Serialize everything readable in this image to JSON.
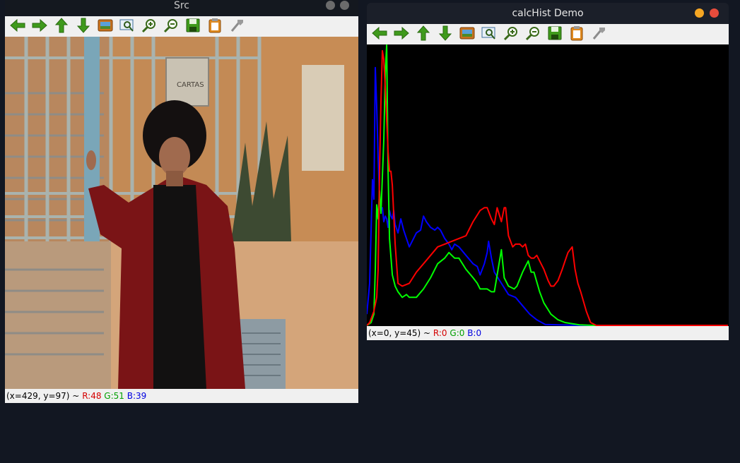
{
  "src_window": {
    "title": "Src",
    "status": {
      "coords": "(x=429, y=97) ~",
      "r": "R:48",
      "g": "G:51",
      "b": "B:39"
    },
    "photo": {
      "sign_text": "CARTAS"
    }
  },
  "hist_window": {
    "title": "calcHist Demo",
    "status": {
      "coords": "(x=0, y=45) ~",
      "r": "R:0",
      "g": "G:0",
      "b": "B:0"
    }
  },
  "toolbar_icons": [
    "pan-left-icon",
    "pan-right-icon",
    "pan-up-icon",
    "pan-down-icon",
    "zoom-fit-icon",
    "zoom-area-icon",
    "zoom-in-icon",
    "zoom-out-icon",
    "save-icon",
    "copy-icon",
    "properties-icon"
  ],
  "colors": {
    "red_channel": "#ff0000",
    "green_channel": "#00ff00",
    "blue_channel": "#0000ff",
    "min_button": "#f5a623",
    "close_button": "#e74c3c",
    "inactive_button": "#6b6b6b"
  },
  "chart_data": {
    "type": "line",
    "title": "",
    "xlabel": "",
    "ylabel": "",
    "xlim": [
      0,
      255
    ],
    "ylim": [
      0,
      1
    ],
    "grid": false,
    "series": [
      {
        "color": "blue",
        "points": [
          [
            0,
            0.04
          ],
          [
            2,
            0.15
          ],
          [
            4,
            0.52
          ],
          [
            5,
            0.45
          ],
          [
            6,
            0.92
          ],
          [
            7,
            0.78
          ],
          [
            8,
            0.6
          ],
          [
            9,
            0.46
          ],
          [
            10,
            0.41
          ],
          [
            11,
            0.42
          ],
          [
            12,
            0.37
          ],
          [
            13,
            0.39
          ],
          [
            14,
            0.38
          ],
          [
            15,
            0.35
          ],
          [
            16,
            0.41
          ],
          [
            17,
            0.39
          ],
          [
            18,
            0.38
          ],
          [
            19,
            0.41
          ],
          [
            20,
            0.36
          ],
          [
            22,
            0.33
          ],
          [
            24,
            0.38
          ],
          [
            26,
            0.34
          ],
          [
            28,
            0.31
          ],
          [
            30,
            0.28
          ],
          [
            32,
            0.3
          ],
          [
            35,
            0.33
          ],
          [
            38,
            0.34
          ],
          [
            40,
            0.39
          ],
          [
            42,
            0.37
          ],
          [
            45,
            0.35
          ],
          [
            48,
            0.34
          ],
          [
            50,
            0.35
          ],
          [
            52,
            0.34
          ],
          [
            55,
            0.31
          ],
          [
            58,
            0.29
          ],
          [
            60,
            0.27
          ],
          [
            62,
            0.29
          ],
          [
            65,
            0.28
          ],
          [
            70,
            0.25
          ],
          [
            75,
            0.22
          ],
          [
            78,
            0.21
          ],
          [
            80,
            0.18
          ],
          [
            83,
            0.22
          ],
          [
            85,
            0.26
          ],
          [
            86,
            0.3
          ],
          [
            88,
            0.24
          ],
          [
            90,
            0.19
          ],
          [
            95,
            0.15
          ],
          [
            100,
            0.11
          ],
          [
            105,
            0.1
          ],
          [
            110,
            0.07
          ],
          [
            115,
            0.04
          ],
          [
            120,
            0.02
          ],
          [
            126,
            0.003
          ],
          [
            150,
            0
          ],
          [
            255,
            0
          ]
        ]
      },
      {
        "color": "green",
        "points": [
          [
            0,
            0
          ],
          [
            3,
            0.01
          ],
          [
            5,
            0.04
          ],
          [
            6,
            0.2
          ],
          [
            7,
            0.43
          ],
          [
            8,
            0.38
          ],
          [
            9,
            0.48
          ],
          [
            10,
            0.4
          ],
          [
            12,
            0.66
          ],
          [
            13,
            0.9
          ],
          [
            14,
            1.0
          ],
          [
            15,
            0.55
          ],
          [
            16,
            0.31
          ],
          [
            18,
            0.18
          ],
          [
            20,
            0.14
          ],
          [
            22,
            0.12
          ],
          [
            25,
            0.1
          ],
          [
            28,
            0.11
          ],
          [
            30,
            0.1
          ],
          [
            35,
            0.1
          ],
          [
            40,
            0.13
          ],
          [
            45,
            0.17
          ],
          [
            50,
            0.22
          ],
          [
            55,
            0.24
          ],
          [
            58,
            0.26
          ],
          [
            60,
            0.25
          ],
          [
            62,
            0.24
          ],
          [
            65,
            0.24
          ],
          [
            70,
            0.2
          ],
          [
            75,
            0.17
          ],
          [
            78,
            0.15
          ],
          [
            80,
            0.13
          ],
          [
            85,
            0.13
          ],
          [
            88,
            0.12
          ],
          [
            90,
            0.12
          ],
          [
            93,
            0.21
          ],
          [
            95,
            0.27
          ],
          [
            97,
            0.17
          ],
          [
            100,
            0.14
          ],
          [
            104,
            0.13
          ],
          [
            106,
            0.14
          ],
          [
            110,
            0.19
          ],
          [
            112,
            0.21
          ],
          [
            114,
            0.23
          ],
          [
            116,
            0.19
          ],
          [
            118,
            0.19
          ],
          [
            122,
            0.12
          ],
          [
            125,
            0.08
          ],
          [
            130,
            0.04
          ],
          [
            135,
            0.02
          ],
          [
            140,
            0.01
          ],
          [
            150,
            0.002
          ],
          [
            160,
            0
          ],
          [
            255,
            0
          ]
        ]
      },
      {
        "color": "red",
        "points": [
          [
            0,
            0
          ],
          [
            2,
            0.01
          ],
          [
            5,
            0.05
          ],
          [
            7,
            0.1
          ],
          [
            8,
            0.2
          ],
          [
            9,
            0.55
          ],
          [
            10,
            0.8
          ],
          [
            11,
            0.98
          ],
          [
            12,
            0.95
          ],
          [
            13,
            0.85
          ],
          [
            15,
            0.62
          ],
          [
            16,
            0.55
          ],
          [
            17,
            0.55
          ],
          [
            18,
            0.5
          ],
          [
            20,
            0.29
          ],
          [
            22,
            0.15
          ],
          [
            25,
            0.14
          ],
          [
            30,
            0.15
          ],
          [
            35,
            0.19
          ],
          [
            40,
            0.22
          ],
          [
            45,
            0.25
          ],
          [
            50,
            0.28
          ],
          [
            55,
            0.29
          ],
          [
            60,
            0.3
          ],
          [
            65,
            0.31
          ],
          [
            70,
            0.32
          ],
          [
            75,
            0.37
          ],
          [
            80,
            0.41
          ],
          [
            83,
            0.42
          ],
          [
            85,
            0.42
          ],
          [
            88,
            0.38
          ],
          [
            90,
            0.36
          ],
          [
            92,
            0.42
          ],
          [
            95,
            0.37
          ],
          [
            97,
            0.42
          ],
          [
            98,
            0.42
          ],
          [
            100,
            0.32
          ],
          [
            103,
            0.28
          ],
          [
            105,
            0.29
          ],
          [
            108,
            0.29
          ],
          [
            110,
            0.28
          ],
          [
            112,
            0.29
          ],
          [
            114,
            0.25
          ],
          [
            116,
            0.24
          ],
          [
            118,
            0.24
          ],
          [
            120,
            0.25
          ],
          [
            122,
            0.23
          ],
          [
            125,
            0.2
          ],
          [
            128,
            0.16
          ],
          [
            130,
            0.14
          ],
          [
            132,
            0.14
          ],
          [
            135,
            0.16
          ],
          [
            138,
            0.2
          ],
          [
            140,
            0.23
          ],
          [
            142,
            0.26
          ],
          [
            145,
            0.28
          ],
          [
            147,
            0.2
          ],
          [
            149,
            0.15
          ],
          [
            151,
            0.12
          ],
          [
            155,
            0.05
          ],
          [
            158,
            0.01
          ],
          [
            162,
            0
          ],
          [
            255,
            0
          ]
        ]
      }
    ]
  }
}
